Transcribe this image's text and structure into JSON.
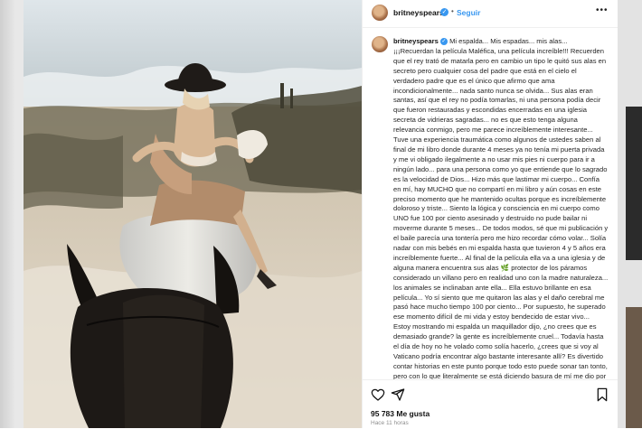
{
  "post": {
    "username": "britneyspears",
    "separator": "•",
    "follow_label": "Seguir",
    "more_label": "•••",
    "caption_user": "britneyspears",
    "caption_text": "Mi espalda... Mis espadas... mis alas... ¡¡¡Recuerdan la película Maléfica, una película increíble!!! Recuerden que el rey trató de matarla pero en cambio un tipo le quitó sus alas en secreto pero cualquier cosa del padre que está en el cielo el verdadero padre que es el único que afirmo que ama incondicionalmente... nada santo nunca se olvida... Sus alas eran santas, así que el rey no podía tomarlas, ni una persona podía decir que fueron restauradas y escondidas encerradas en una iglesia secreta de vidrieras sagradas... no es que esto tenga alguna relevancia conmigo, pero me parece increíblemente interesante... Tuve una experiencia traumática como algunos de ustedes saben al final de mi libro donde durante 4 meses ya no tenía mi puerta privada y me vi obligado ilegalmente a no usar mis pies ni cuerpo para ir a ningún lado... para una persona como yo que entiende que lo sagrado es la velocidad de Dios... Hizo más que lastimar mi cuerpo... Confía en mí, hay MUCHO que no compartí en mi libro y aún cosas en este preciso momento que he mantenido ocultas porque es increíblemente doloroso y triste... Siento la lógica y consciencia en mi cuerpo como UNO fue 100 por ciento asesinado y destruido no pude bailar ni moverme durante 5 meses... De todos modos, sé que mi publicación y el baile parecía una tontería pero me hizo recordar cómo volar... Solía nadar con mis bebés en mi espalda hasta que tuvieron 4 y 5 años era increíblemente fuerte... Al final de la película ella va a una iglesia y de alguna manera encuentra sus alas 🌿 protector de los páramos considerado un villano pero en realidad uno con la madre naturaleza... los animales se inclinaban ante ella... Ella estuvo brillante en esa película... Yo sí siento que me quitaron las alas y el daño cerebral me pasó hace mucho tiempo 100 por ciento... Por supuesto, he superado ese momento difícil de mi vida y estoy bendecido de estar vivo... Estoy mostrando mi espalda un maquillador dijo, ¿no crees que es demasiado grande? la gente es increíblemente cruel... Todavía hasta el día de hoy no he volado como solía hacerlo, ¿crees que si voy al Vaticano podría encontrar algo bastante interesante allí? Es divertido contar historias en este punto porque todo esto puede sonar tan tonto, pero con lo que literalmente se está diciendo basura de mí me dio por qué no traer SUSTANCIA a la",
    "likes": "95 783 Me gusta",
    "time": "Hace 11 horas"
  },
  "icons": {
    "verified": "verified-badge-icon",
    "like": "heart-icon",
    "share": "send-icon",
    "save": "bookmark-icon"
  },
  "colors": {
    "accent": "#3897f0",
    "text": "#262626",
    "muted": "#8e8e8e"
  }
}
